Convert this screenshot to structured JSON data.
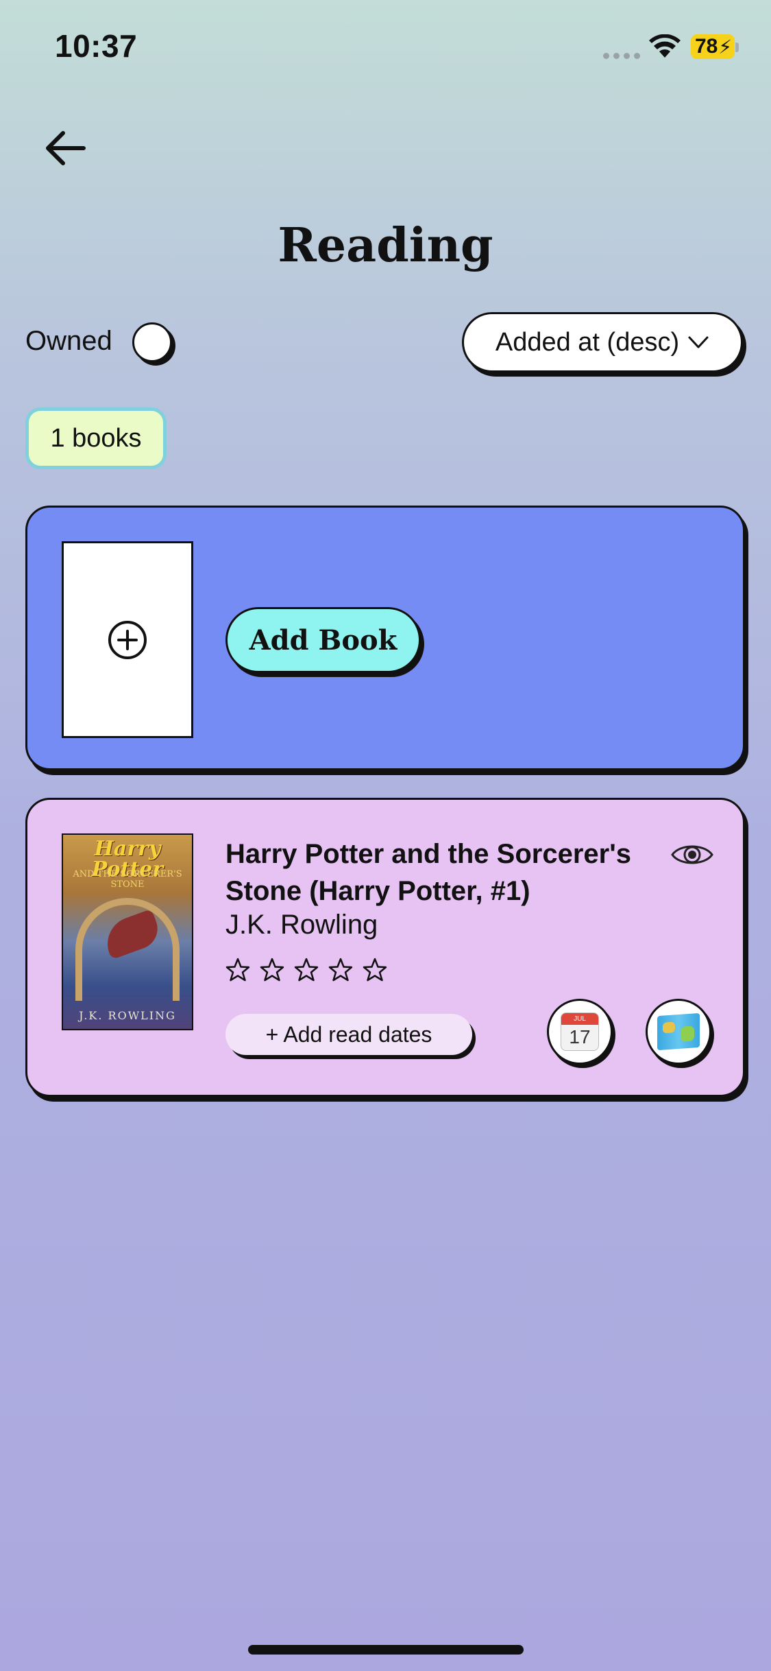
{
  "status_bar": {
    "time": "10:37",
    "battery": "78"
  },
  "header": {
    "title": "Reading"
  },
  "filters": {
    "owned_label": "Owned",
    "sort_label": "Added at (desc)"
  },
  "count_badge": "1 books",
  "add_card": {
    "button_label": "Add Book"
  },
  "books": [
    {
      "title": "Harry Potter and the Sorcerer's Stone (Harry Potter, #1)",
      "author": "J.K. Rowling",
      "rating": 0,
      "rating_max": 5,
      "add_dates_label": "+ Add read dates",
      "cover": {
        "title_line": "Harry Potter",
        "subtitle": "AND THE SORCERER'S STONE",
        "author": "J.K. ROWLING"
      },
      "calendar": {
        "month": "JUL",
        "day": "17"
      }
    }
  ],
  "icons": {
    "back": "arrow-left-icon",
    "add": "plus-circle-icon",
    "visibility": "eye-icon",
    "calendar": "calendar-icon",
    "map": "map-icon"
  },
  "colors": {
    "add_card_bg": "#768cf5",
    "book_card_bg": "#e7c3f4",
    "add_button_bg": "#8ff4f0",
    "count_badge_bg": "#ebfbc8",
    "count_badge_border": "#7fd1dd"
  }
}
